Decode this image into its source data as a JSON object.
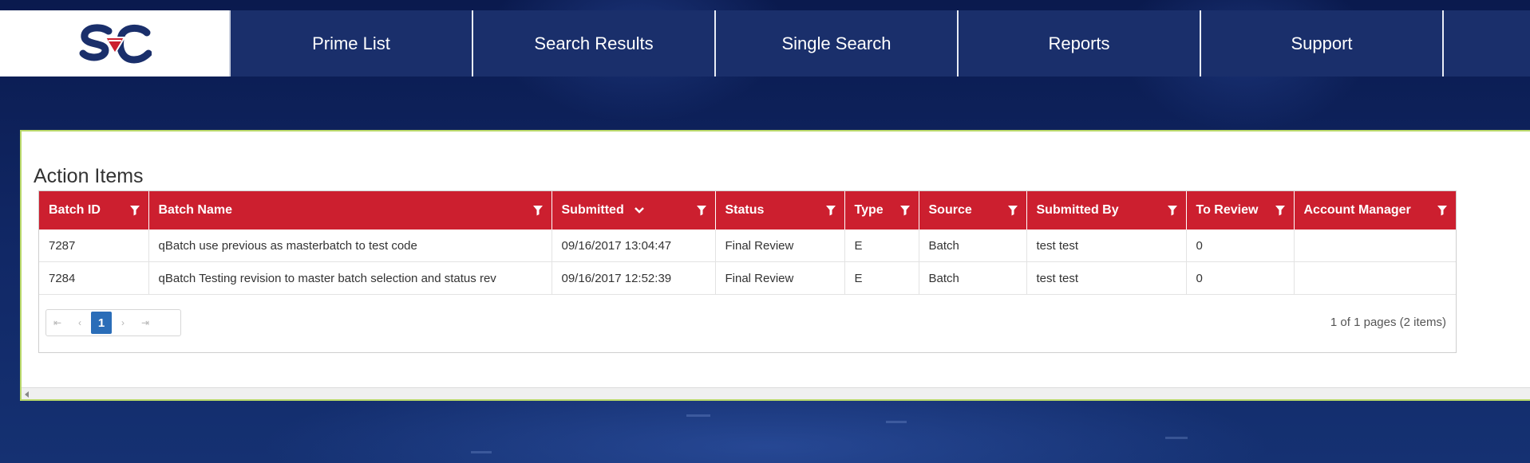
{
  "nav": {
    "logo_icon": "sc-logo-icon",
    "items": [
      {
        "label": "Prime List"
      },
      {
        "label": "Search Results"
      },
      {
        "label": "Single Search"
      },
      {
        "label": "Reports"
      },
      {
        "label": "Support"
      }
    ]
  },
  "panel": {
    "title": "Action Items"
  },
  "grid": {
    "columns": [
      {
        "label": "Batch ID",
        "filter_icon": "filter-icon"
      },
      {
        "label": "Batch Name",
        "filter_icon": "filter-icon"
      },
      {
        "label": "Submitted",
        "filter_icon": "filter-icon",
        "sort_icon": "chevron-down-icon"
      },
      {
        "label": "Status",
        "filter_icon": "filter-icon"
      },
      {
        "label": "Type",
        "filter_icon": "filter-icon"
      },
      {
        "label": "Source",
        "filter_icon": "filter-icon"
      },
      {
        "label": "Submitted By",
        "filter_icon": "filter-icon"
      },
      {
        "label": "To Review",
        "filter_icon": "filter-icon"
      },
      {
        "label": "Account Manager",
        "filter_icon": "filter-icon"
      }
    ],
    "rows": [
      {
        "batch_id": "7287",
        "batch_name": "qBatch use previous as masterbatch to test code",
        "submitted": "09/16/2017 13:04:47",
        "status": "Final Review",
        "type": "E",
        "source": "Batch",
        "submitted_by": "test test",
        "to_review": "0",
        "account_manager": ""
      },
      {
        "batch_id": "7284",
        "batch_name": "qBatch Testing revision to master batch selection and status rev",
        "submitted": "09/16/2017 12:52:39",
        "status": "Final Review",
        "type": "E",
        "source": "Batch",
        "submitted_by": "test test",
        "to_review": "0",
        "account_manager": ""
      }
    ]
  },
  "pager": {
    "current_page": "1",
    "info": "1 of 1 pages (2 items)"
  },
  "colors": {
    "nav_bg": "#1a2f6b",
    "header_red": "#cc1f2f",
    "page_active": "#2a6db8"
  }
}
